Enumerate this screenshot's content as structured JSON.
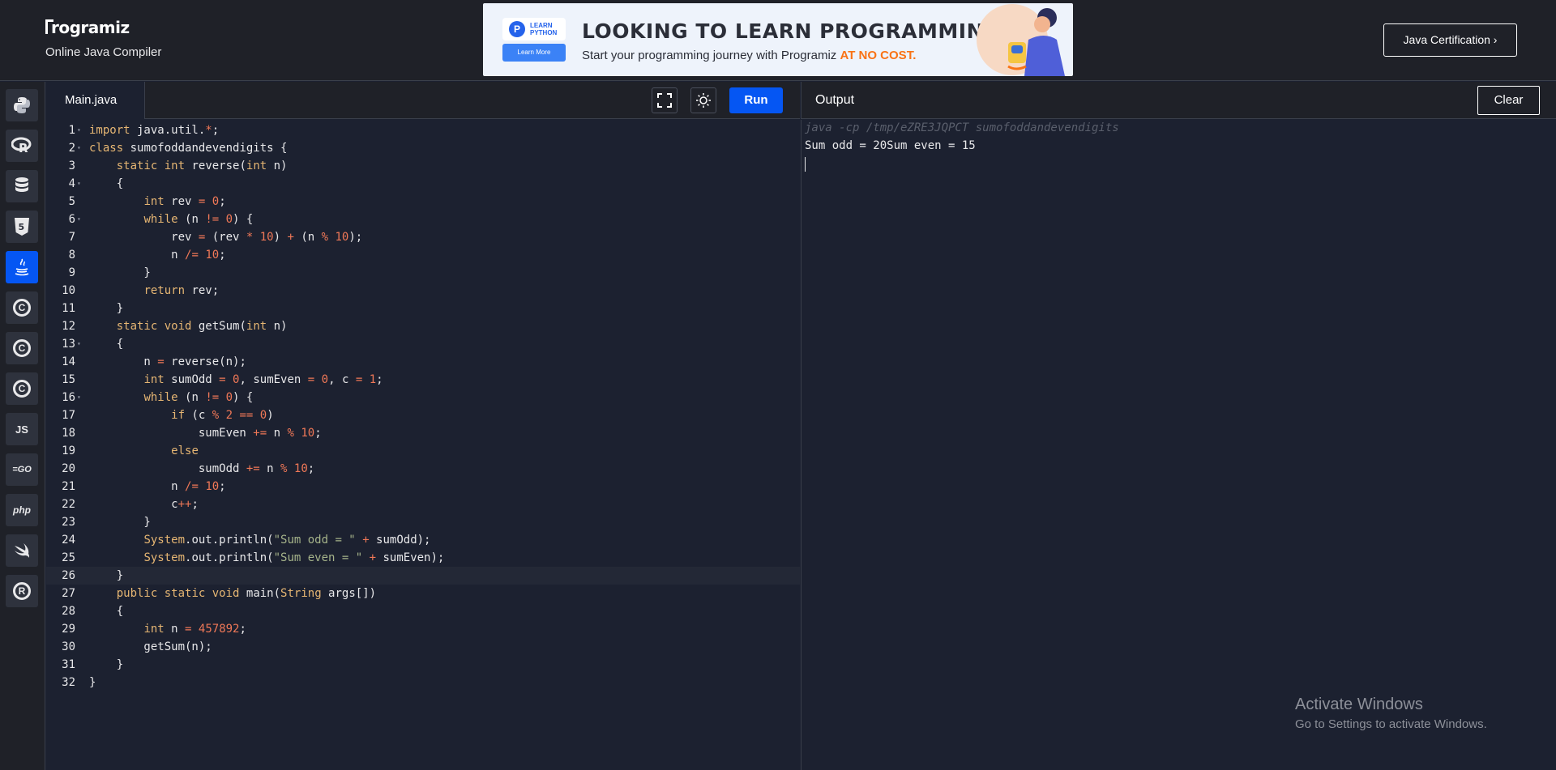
{
  "header": {
    "logo_text": "rogramiz",
    "subtitle": "Online Java Compiler",
    "cert_button": "Java Certification ›"
  },
  "ad": {
    "badge": "LEARN PYTHON",
    "learn_more": "Learn More",
    "headline": "LOOKING TO LEARN PROGRAMMING?",
    "tagline": "Start your programming journey with Programiz",
    "tagline_highlight": "AT NO COST."
  },
  "sidebar": {
    "languages": [
      {
        "name": "python",
        "icon": "python-icon"
      },
      {
        "name": "r",
        "icon": "r-icon"
      },
      {
        "name": "sql",
        "icon": "database-icon"
      },
      {
        "name": "html",
        "icon": "html5-icon"
      },
      {
        "name": "java",
        "icon": "java-icon",
        "active": true
      },
      {
        "name": "c",
        "icon": "c-icon",
        "label": "C"
      },
      {
        "name": "cpp",
        "icon": "cpp-icon",
        "label": "C"
      },
      {
        "name": "csharp",
        "icon": "csharp-icon",
        "label": "C"
      },
      {
        "name": "js",
        "icon": "js-icon",
        "label": "JS"
      },
      {
        "name": "go",
        "icon": "go-icon",
        "label": "=GO"
      },
      {
        "name": "php",
        "icon": "php-icon",
        "label": "php"
      },
      {
        "name": "swift",
        "icon": "swift-icon"
      },
      {
        "name": "rust",
        "icon": "rust-icon",
        "label": "R"
      }
    ]
  },
  "editor": {
    "file_tab": "Main.java",
    "run_label": "Run",
    "lines": [
      "import java.util.*;",
      "class sumofoddandevendigits {",
      "    static int reverse(int n)",
      "    {",
      "        int rev = 0;",
      "        while (n != 0) {",
      "            rev = (rev * 10) + (n % 10);",
      "            n /= 10;",
      "        }",
      "        return rev;",
      "    }",
      "    static void getSum(int n)",
      "    {",
      "        n = reverse(n);",
      "        int sumOdd = 0, sumEven = 0, c = 1;",
      "        while (n != 0) {",
      "            if (c % 2 == 0)",
      "                sumEven += n % 10;",
      "            else",
      "                sumOdd += n % 10;",
      "            n /= 10;",
      "            c++;",
      "        }",
      "        System.out.println(\"Sum odd = \" + sumOdd);",
      "        System.out.println(\"Sum even = \" + sumEven);",
      "    }",
      "    public static void main(String args[])",
      "    {",
      "        int n = 457892;",
      "        getSum(n);",
      "    }",
      "}"
    ],
    "fold_lines": [
      1,
      2,
      4,
      6,
      13,
      16
    ],
    "highlighted_line": 26
  },
  "output": {
    "title": "Output",
    "clear_label": "Clear",
    "command": "java -cp /tmp/eZRE3JQPCT sumofoddandevendigits",
    "result": "Sum odd = 20Sum even = 15"
  },
  "watermark": {
    "line1": "Activate Windows",
    "line2": "Go to Settings to activate Windows."
  },
  "colors": {
    "accent": "#0556f3",
    "background": "#1c2130",
    "panel": "#1f2128",
    "keyword": "#e6b673",
    "number": "#f07857",
    "string": "#a5b38a"
  }
}
